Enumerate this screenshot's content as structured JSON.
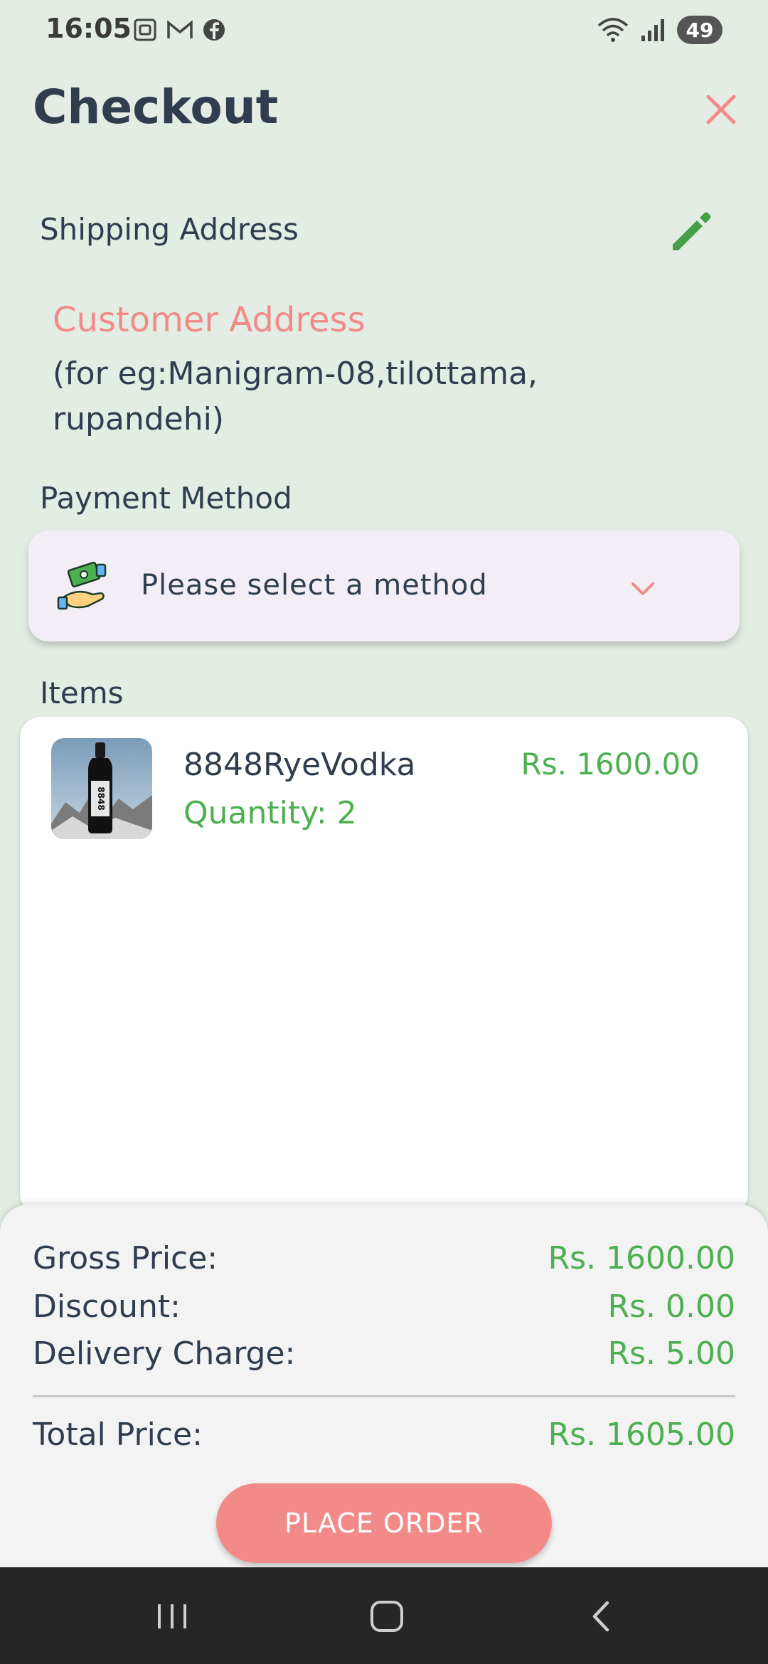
{
  "status_bar": {
    "time": "16:05",
    "left_icons": [
      "screenshot-icon",
      "gmail-icon",
      "facebook-icon"
    ],
    "right_icons": [
      "wifi-icon",
      "signal-icon"
    ],
    "battery": "49"
  },
  "header": {
    "title": "Checkout",
    "close_icon": "close-icon"
  },
  "shipping": {
    "label": "Shipping Address",
    "edit_icon": "pencil-icon",
    "address_title": "Customer Address",
    "address_hint": "(for eg:Manigram-08,tilottama, rupandehi)"
  },
  "payment": {
    "label": "Payment Method",
    "icon": "payment-hands-icon",
    "placeholder": "Please select a method",
    "chevron_icon": "chevron-down-icon"
  },
  "items": {
    "label": "Items",
    "list": [
      {
        "name": "8848RyeVodka",
        "quantity_text": "Quantity: 2",
        "price": "Rs. 1600.00",
        "thumb_label": "8848"
      }
    ]
  },
  "summary": {
    "gross_label": "Gross Price:",
    "gross_value": "Rs. 1600.00",
    "discount_label": "Discount:",
    "discount_value": "Rs. 0.00",
    "delivery_label": "Delivery Charge:",
    "delivery_value": "Rs. 5.00",
    "total_label": "Total Price:",
    "total_value": "Rs. 1605.00",
    "place_order_label": "PLACE ORDER"
  },
  "colors": {
    "background": "#e3ede3",
    "accent_red": "#f28b88",
    "accent_green": "#4caf50",
    "text_dark": "#2f3d4e"
  },
  "nav_bar": {
    "icons": [
      "recent-apps-icon",
      "home-icon",
      "back-icon"
    ]
  }
}
